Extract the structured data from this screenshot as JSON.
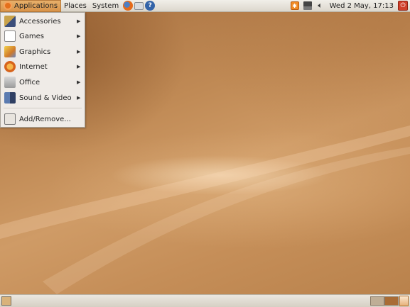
{
  "top_panel": {
    "menus": {
      "applications": "Applications",
      "places": "Places",
      "system": "System"
    },
    "launchers": [
      "firefox-icon",
      "mail-icon",
      "help-icon"
    ],
    "help_glyph": "?",
    "clock": "Wed  2 May, 17:13",
    "tray_icons": [
      "notification-icon",
      "network-icon",
      "volume-icon",
      "power-icon"
    ]
  },
  "applications_menu": {
    "items": [
      {
        "label": "Accessories",
        "icon": "accessories-icon",
        "submenu": true
      },
      {
        "label": "Games",
        "icon": "games-icon",
        "submenu": true
      },
      {
        "label": "Graphics",
        "icon": "graphics-icon",
        "submenu": true
      },
      {
        "label": "Internet",
        "icon": "internet-icon",
        "submenu": true
      },
      {
        "label": "Office",
        "icon": "office-icon",
        "submenu": true
      },
      {
        "label": "Sound & Video",
        "icon": "sound-video-icon",
        "submenu": true
      }
    ],
    "footer_item": {
      "label": "Add/Remove...",
      "icon": "add-remove-icon"
    }
  },
  "bottom_panel": {
    "workspaces": [
      "workspace-1",
      "workspace-2"
    ],
    "active_workspace_color": "#a96c35"
  },
  "theme": {
    "accent": "#d9944a",
    "wallpaper_base": "#c08a55"
  }
}
